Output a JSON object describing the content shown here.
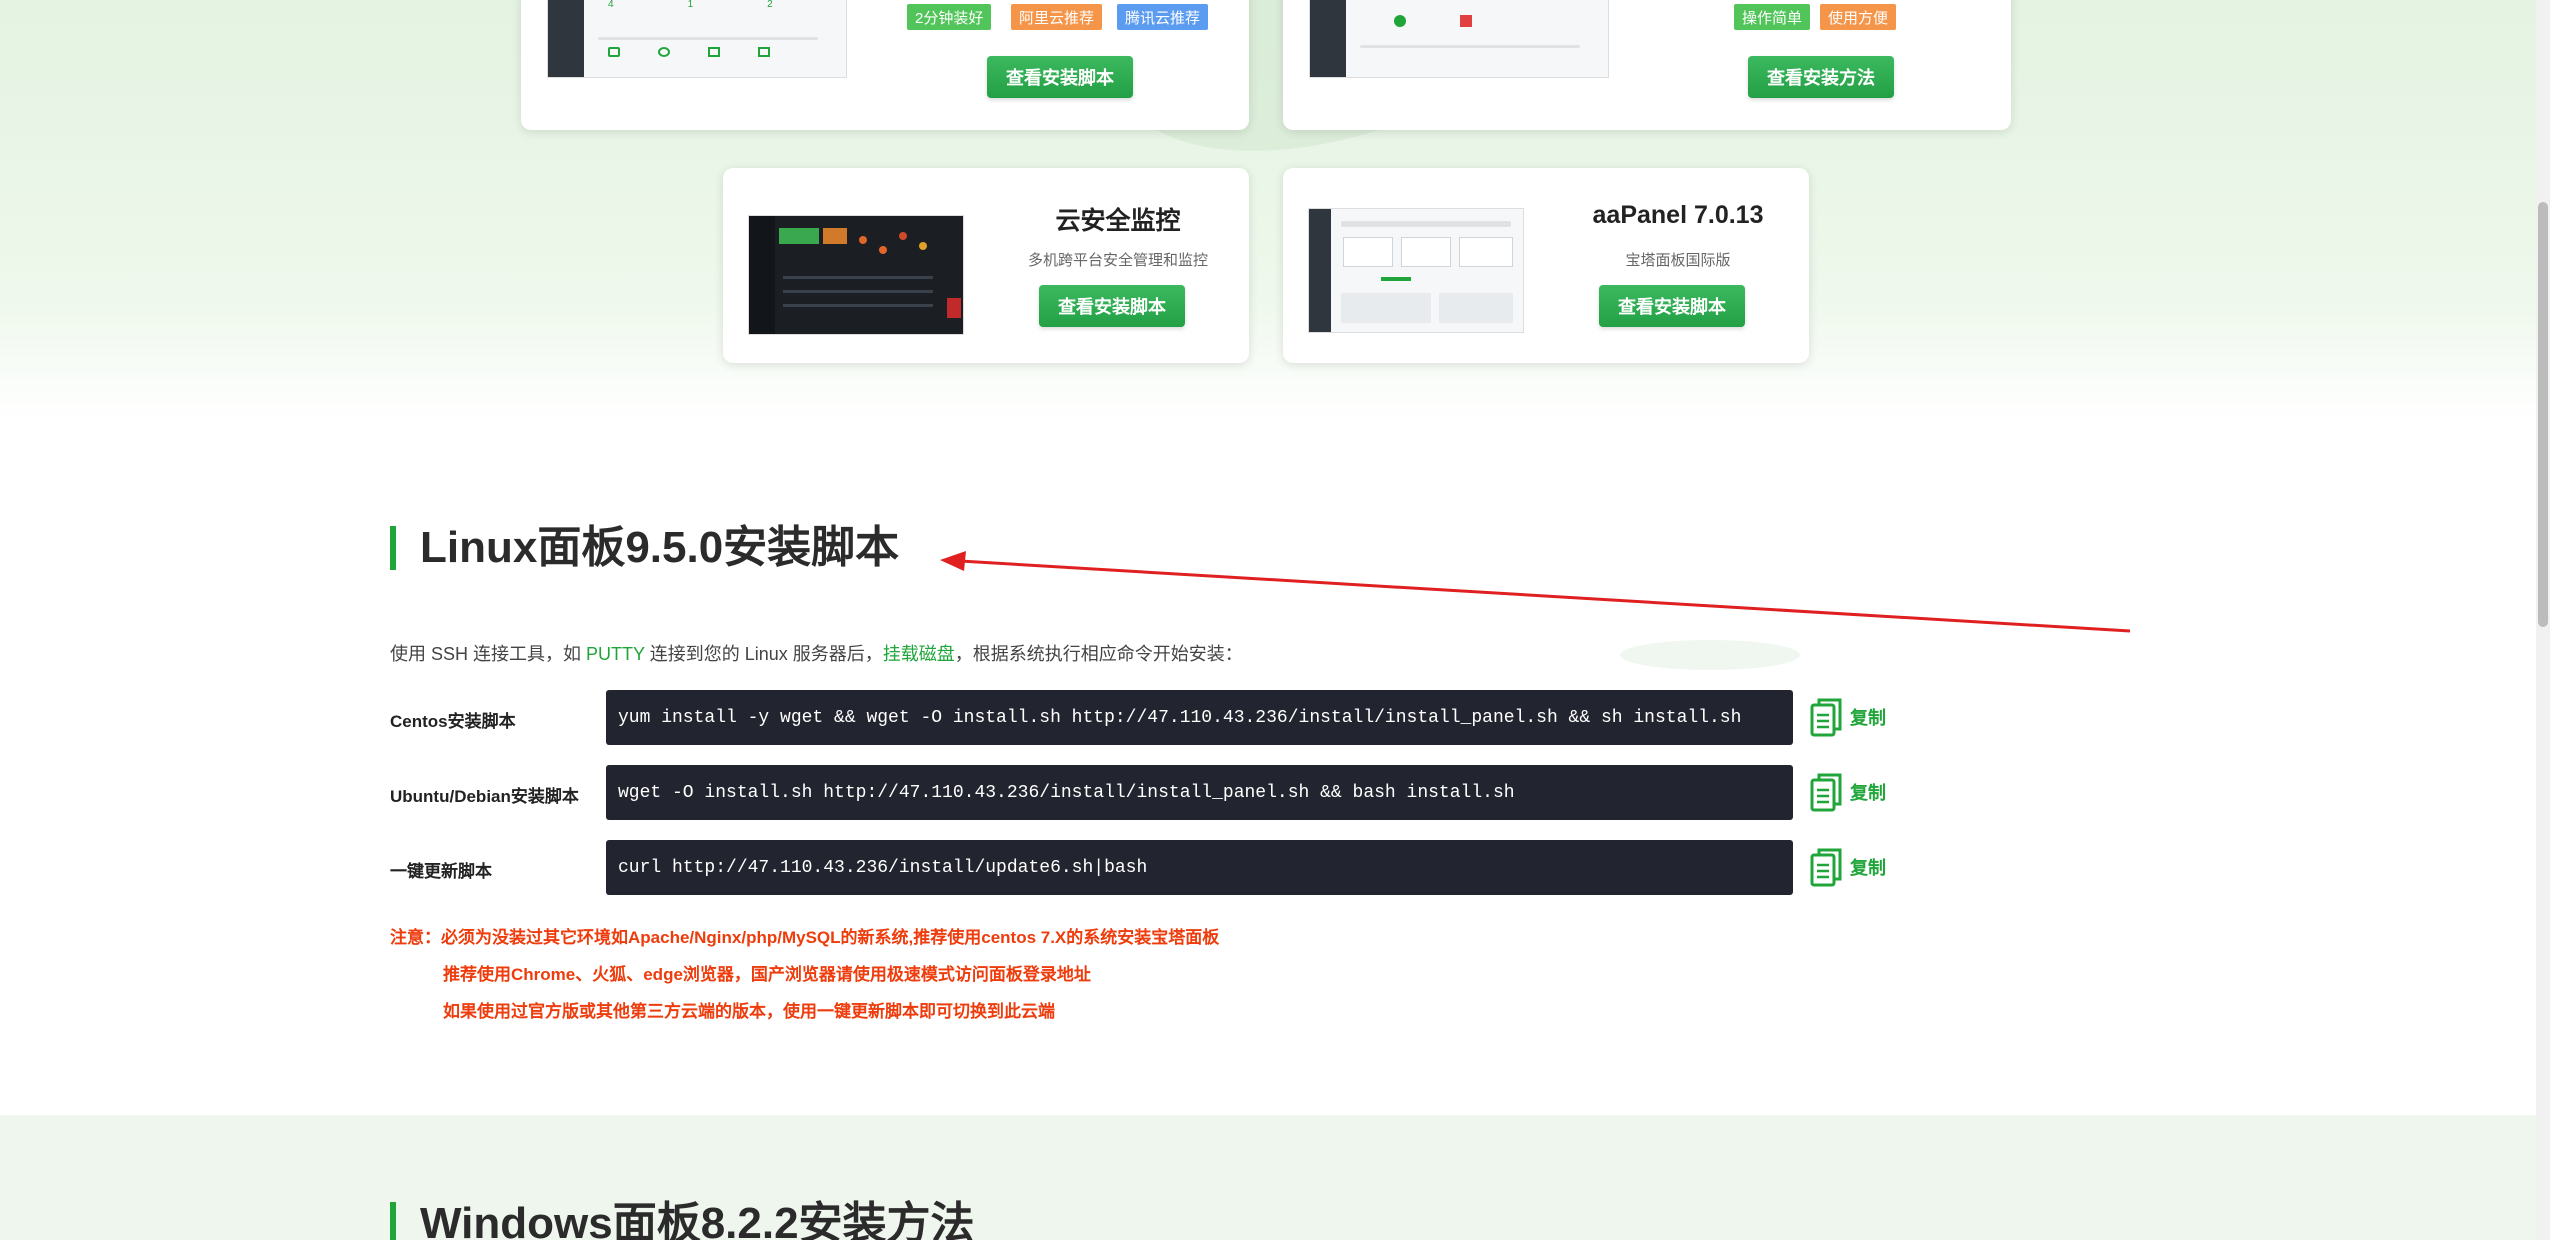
{
  "top_cards": {
    "left": {
      "tags": [
        "2分钟装好",
        "阿里云推荐",
        "腾讯云推荐"
      ],
      "tag_colors": [
        "#52c55a",
        "#f5954a",
        "#5c9cf0"
      ],
      "stat_numbers": [
        "4",
        "1",
        "2",
        "4"
      ],
      "button": "查看安装脚本"
    },
    "right": {
      "tags": [
        "操作简单",
        "使用方便"
      ],
      "tag_colors": [
        "#52c55a",
        "#f5954a"
      ],
      "button": "查看安装方法"
    }
  },
  "cards": [
    {
      "title": "云安全监控",
      "subtitle": "多机跨平台安全管理和监控",
      "button": "查看安装脚本"
    },
    {
      "title": "aaPanel 7.0.13",
      "subtitle": "宝塔面板国际版",
      "button": "查看安装脚本"
    }
  ],
  "linux_section": {
    "title": "Linux面板9.5.0安装脚本",
    "intro_1": "使用 SSH 连接工具，如 ",
    "intro_putty": "PUTTY",
    "intro_2": " 连接到您的 Linux 服务器后，",
    "intro_mount": "挂载磁盘",
    "intro_3": "，根据系统执行相应命令开始安装：",
    "rows": [
      {
        "label": "Centos安装脚本",
        "command": "yum install -y wget && wget -O install.sh http://47.110.43.236/install/install_panel.sh && sh install.sh",
        "copy": "复制"
      },
      {
        "label": "Ubuntu/Debian安装脚本",
        "command": "wget -O install.sh http://47.110.43.236/install/install_panel.sh && bash install.sh",
        "copy": "复制"
      },
      {
        "label": "一键更新脚本",
        "command": "curl http://47.110.43.236/install/update6.sh|bash",
        "copy": "复制"
      }
    ],
    "notes": [
      "注意：必须为没装过其它环境如Apache/Nginx/php/MySQL的新系统,推荐使用centos 7.X的系统安装宝塔面板",
      "推荐使用Chrome、火狐、edge浏览器，国产浏览器请使用极速模式访问面板登录地址",
      "如果使用过官方版或其他第三方云端的版本，使用一键更新脚本即可切换到此云端"
    ]
  },
  "windows_section": {
    "title": "Windows面板8.2.2安装方法"
  },
  "colors": {
    "brand_green": "#20a53a",
    "note_red": "#ee3c0c",
    "code_bg": "#22252f",
    "arrow_red": "#e02020"
  }
}
